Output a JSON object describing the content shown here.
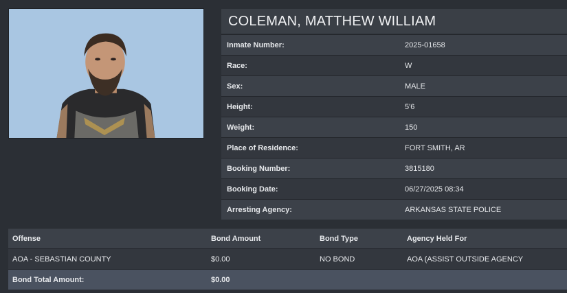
{
  "inmate": {
    "name": "COLEMAN, MATTHEW WILLIAM",
    "details": [
      {
        "label": "Inmate Number:",
        "value": "2025-01658"
      },
      {
        "label": "Race:",
        "value": "W"
      },
      {
        "label": "Sex:",
        "value": "MALE"
      },
      {
        "label": "Height:",
        "value": "5'6"
      },
      {
        "label": "Weight:",
        "value": "150"
      },
      {
        "label": "Place of Residence:",
        "value": "FORT SMITH, AR"
      },
      {
        "label": "Booking Number:",
        "value": "3815180"
      },
      {
        "label": "Booking Date:",
        "value": "06/27/2025 08:34"
      },
      {
        "label": "Arresting Agency:",
        "value": "ARKANSAS STATE POLICE"
      }
    ]
  },
  "charges": {
    "headers": [
      "Offense",
      "Bond Amount",
      "Bond Type",
      "Agency Held For"
    ],
    "rows": [
      [
        "AOA - SEBASTIAN COUNTY",
        "$0.00",
        "NO BOND",
        "AOA (ASSIST OUTSIDE AGENCY"
      ]
    ],
    "total_label": "Bond Total Amount:",
    "total_value": "$0.00"
  },
  "colors": {
    "background": "#2b2f35",
    "row_odd": "#3c4149",
    "row_even": "#33373e",
    "total_row": "#4a5260",
    "photo_backdrop": "#a9c6e2"
  }
}
